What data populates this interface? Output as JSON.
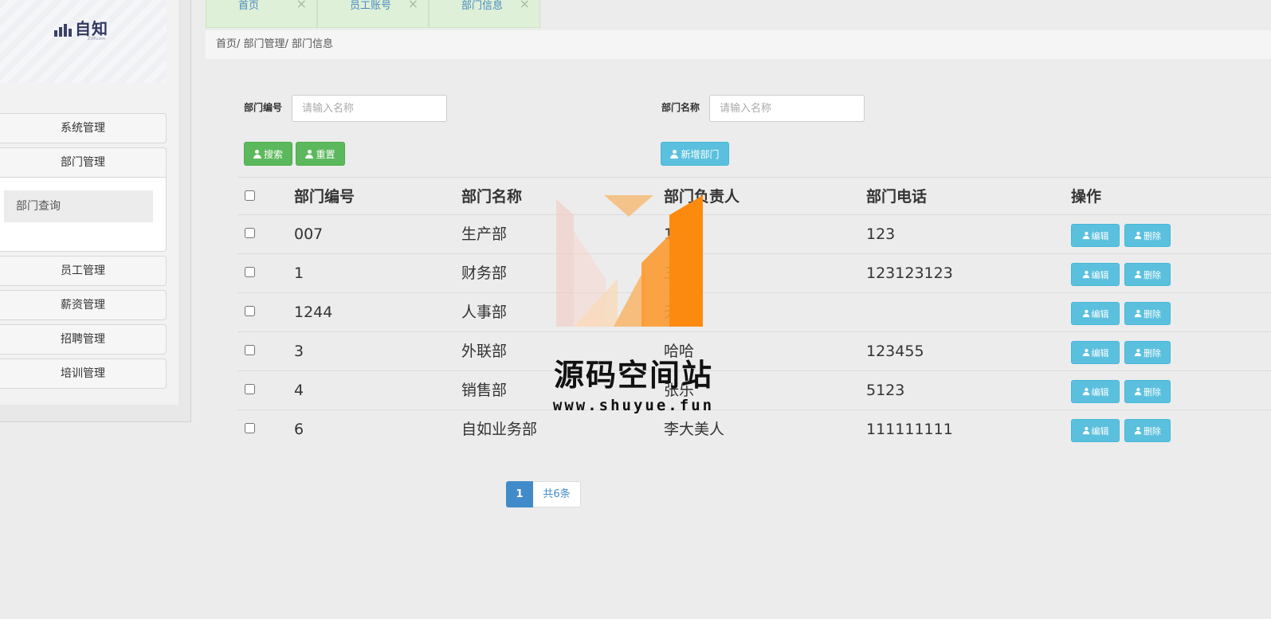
{
  "logo": {
    "text": "自知",
    "sub": "ZiHuom"
  },
  "sidebar": {
    "items": [
      {
        "label": "系统管理"
      },
      {
        "label": "部门管理"
      },
      {
        "label": "员工管理"
      },
      {
        "label": "薪资管理"
      },
      {
        "label": "招聘管理"
      },
      {
        "label": "培训管理"
      }
    ],
    "submenu": {
      "label": "部门查询"
    }
  },
  "tabs": [
    {
      "label": "首页",
      "close": "×"
    },
    {
      "label": "员工账号",
      "close": "×"
    },
    {
      "label": "部门信息",
      "close": "×"
    }
  ],
  "breadcrumb": "首页/ 部门管理/ 部门信息",
  "search": {
    "dept_no_label": "部门编号",
    "dept_no_placeholder": "请输入名称",
    "dept_name_label": "部门名称",
    "dept_name_placeholder": "请输入名称",
    "search_btn": "搜索",
    "reset_btn": "重置",
    "add_btn": "新增部门"
  },
  "table": {
    "headers": [
      "部门编号",
      "部门名称",
      "部门负责人",
      "部门电话",
      "操作"
    ],
    "rows": [
      {
        "no": "007",
        "name": "生产部",
        "head": "123",
        "phone": "123"
      },
      {
        "no": "1",
        "name": "财务部",
        "head": "三",
        "phone": "123123123"
      },
      {
        "no": "1244",
        "name": "人事部",
        "head": "天",
        "phone": ""
      },
      {
        "no": "3",
        "name": "外联部",
        "head": "哈哈",
        "phone": "123455"
      },
      {
        "no": "4",
        "name": "销售部",
        "head": "张乐",
        "phone": "5123"
      },
      {
        "no": "6",
        "name": "自如业务部",
        "head": "李大美人",
        "phone": "111111111"
      }
    ],
    "edit_label": "编辑",
    "delete_label": "删除"
  },
  "pagination": {
    "current": "1",
    "total": "共6条"
  },
  "watermark": {
    "title": "源码空间站",
    "url": "www.shuyue.fun"
  },
  "colors": {
    "success": "#5cb85c",
    "info": "#5bc0de",
    "primary": "#428bca",
    "tab_bg": "#dff0d8"
  }
}
